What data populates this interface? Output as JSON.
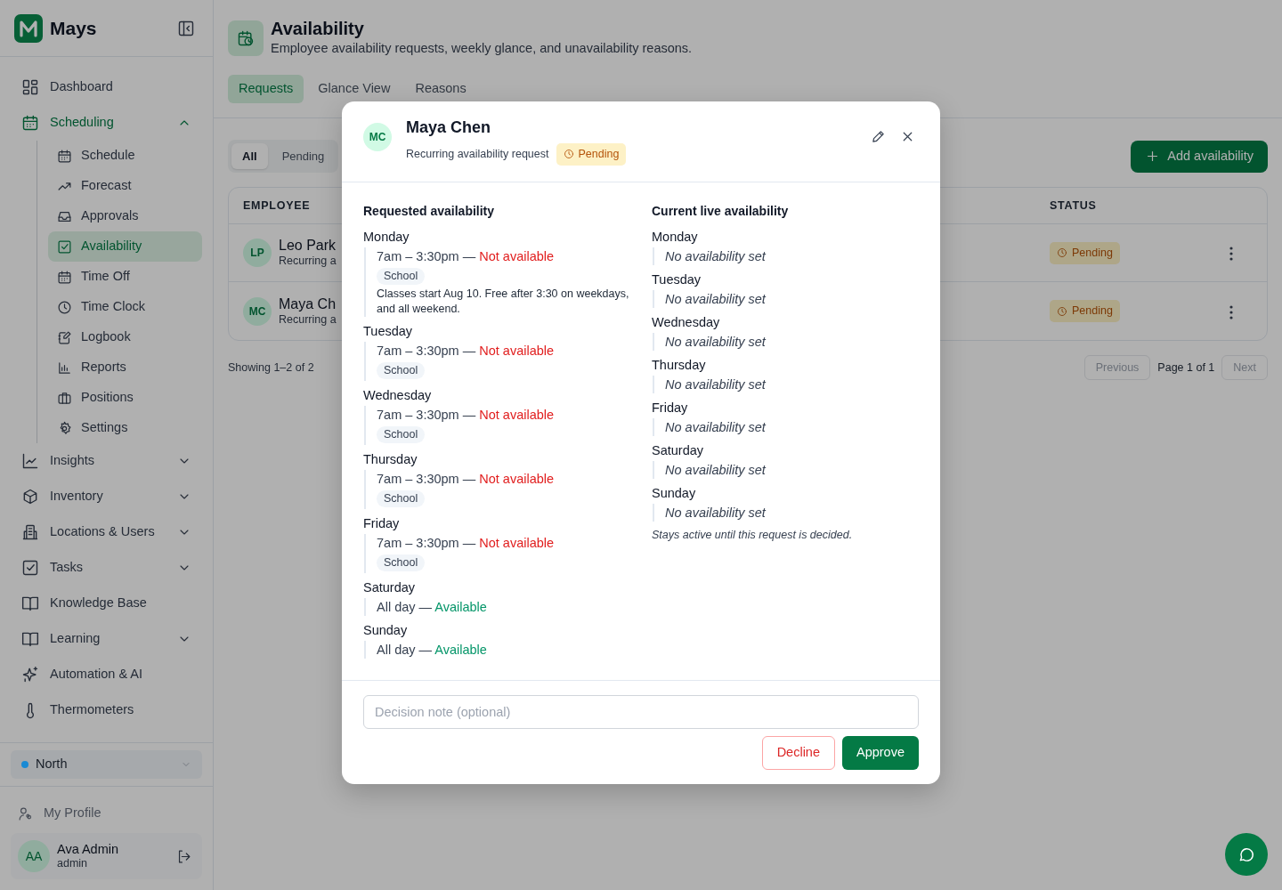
{
  "sidebar": {
    "brand": "Mays",
    "nav": [
      {
        "label": "Dashboard",
        "selected": false
      },
      {
        "label": "Scheduling",
        "selected": false,
        "expanded": true,
        "children": [
          {
            "label": "Schedule",
            "selected": false
          },
          {
            "label": "Forecast",
            "selected": false
          },
          {
            "label": "Approvals",
            "selected": false
          },
          {
            "label": "Availability",
            "selected": true
          },
          {
            "label": "Time Off",
            "selected": false
          },
          {
            "label": "Time Clock",
            "selected": false
          },
          {
            "label": "Logbook",
            "selected": false
          },
          {
            "label": "Reports",
            "selected": false
          },
          {
            "label": "Positions",
            "selected": false
          },
          {
            "label": "Settings",
            "selected": false
          }
        ]
      },
      {
        "label": "Insights",
        "selected": false,
        "expanded": false
      },
      {
        "label": "Inventory",
        "selected": false,
        "expanded": false
      },
      {
        "label": "Locations & Users",
        "selected": false,
        "expanded": false
      },
      {
        "label": "Tasks",
        "selected": false,
        "expanded": false
      },
      {
        "label": "Knowledge Base",
        "selected": false
      },
      {
        "label": "Learning",
        "selected": false,
        "expanded": false
      },
      {
        "label": "Automation & AI",
        "selected": false
      },
      {
        "label": "Thermometers",
        "selected": false
      }
    ],
    "location": {
      "label": "North",
      "color": "#1a8ad4"
    },
    "profile_link": "My Profile",
    "user": {
      "initials": "AA",
      "name": "Ava Admin",
      "role": "admin"
    }
  },
  "page": {
    "title": "Availability",
    "subtitle": "Employee availability requests, weekly glance, and unavailability reasons.",
    "tabs": [
      {
        "label": "Requests",
        "selected": true
      },
      {
        "label": "Glance View",
        "selected": false
      },
      {
        "label": "Reasons",
        "selected": false
      }
    ],
    "filters": [
      {
        "label": "All",
        "selected": true
      },
      {
        "label": "Pending",
        "selected": false
      }
    ],
    "add_button": "Add availability",
    "table": {
      "columns": [
        "EMPLOYEE",
        "STATUS"
      ],
      "rows": [
        {
          "initials": "LP",
          "name": "Leo Park",
          "subtitle": "Recurring a",
          "status": "Pending"
        },
        {
          "initials": "MC",
          "name": "Maya Ch",
          "subtitle": "Recurring a",
          "status": "Pending"
        }
      ]
    },
    "footer": {
      "showing": "Showing 1–2 of 2",
      "previous": "Previous",
      "page": "Page 1 of 1",
      "next": "Next"
    }
  },
  "modal": {
    "initials": "MC",
    "name": "Maya Chen",
    "subtitle": "Recurring availability request",
    "status": "Pending",
    "requested": {
      "title": "Requested availability",
      "days": [
        {
          "day": "Monday",
          "time": "7am – 3:30pm —",
          "availability": "Not available",
          "available": false,
          "tag": "School",
          "note": "Classes start Aug 10. Free after 3:30 on weekdays, and all weekend."
        },
        {
          "day": "Tuesday",
          "time": "7am – 3:30pm —",
          "availability": "Not available",
          "available": false,
          "tag": "School"
        },
        {
          "day": "Wednesday",
          "time": "7am – 3:30pm —",
          "availability": "Not available",
          "available": false,
          "tag": "School"
        },
        {
          "day": "Thursday",
          "time": "7am – 3:30pm —",
          "availability": "Not available",
          "available": false,
          "tag": "School"
        },
        {
          "day": "Friday",
          "time": "7am – 3:30pm —",
          "availability": "Not available",
          "available": false,
          "tag": "School"
        },
        {
          "day": "Saturday",
          "time": "All day —",
          "availability": "Available",
          "available": true
        },
        {
          "day": "Sunday",
          "time": "All day —",
          "availability": "Available",
          "available": true
        }
      ]
    },
    "current": {
      "title": "Current live availability",
      "days": [
        {
          "day": "Monday",
          "text": "No availability set"
        },
        {
          "day": "Tuesday",
          "text": "No availability set"
        },
        {
          "day": "Wednesday",
          "text": "No availability set"
        },
        {
          "day": "Thursday",
          "text": "No availability set"
        },
        {
          "day": "Friday",
          "text": "No availability set"
        },
        {
          "day": "Saturday",
          "text": "No availability set"
        },
        {
          "day": "Sunday",
          "text": "No availability set"
        }
      ],
      "footnote": "Stays active until this request is decided."
    },
    "note_placeholder": "Decision note (optional)",
    "decline": "Decline",
    "approve": "Approve"
  }
}
